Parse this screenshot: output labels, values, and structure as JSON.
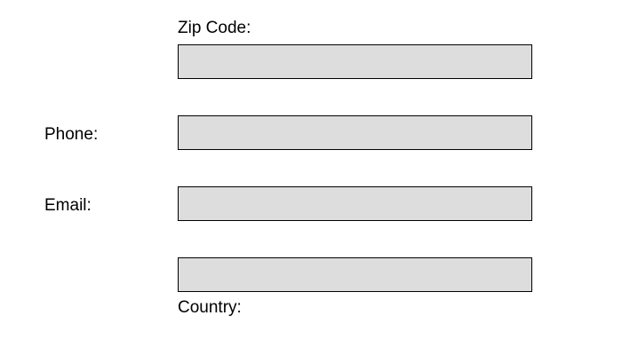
{
  "form": {
    "zip": {
      "label": "Zip Code:",
      "value": "",
      "placeholder": ""
    },
    "phone": {
      "label": "Phone:",
      "value": "",
      "placeholder": ""
    },
    "email": {
      "label": "Email:",
      "value": "",
      "placeholder": ""
    },
    "country": {
      "label": "Country:",
      "value": "",
      "placeholder": ""
    }
  },
  "colors": {
    "field_background": "#dddddd",
    "field_border": "#000000",
    "text": "#000000",
    "page_background": "#ffffff"
  }
}
